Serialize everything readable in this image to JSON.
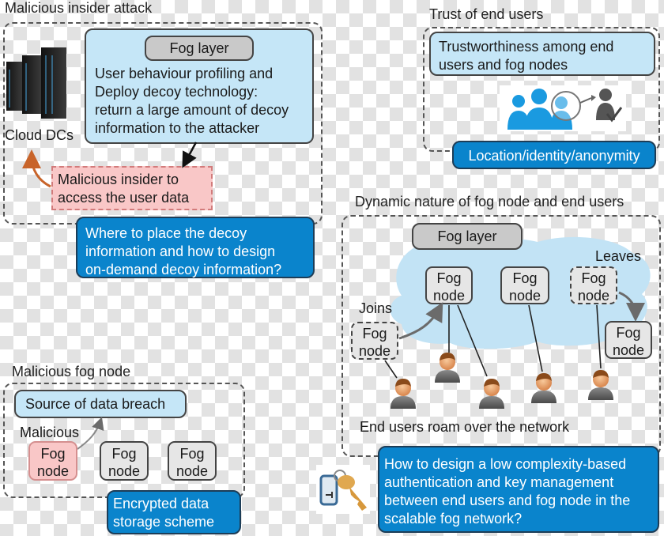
{
  "colors": {
    "light_blue_box": "#c5e6f7",
    "dark_blue_box": "#0a84cc",
    "grey_pill": "#c9c9c9",
    "red_box": "#f9c7c7",
    "cloud": "#c2e3f5",
    "orange_arrow": "#c8642a"
  },
  "insider": {
    "title": "Malicious insider attack",
    "fog_layer": "Fog layer",
    "desc_lines": [
      "User behaviour profiling and",
      "Deploy decoy technology:",
      "return a large amount of decoy",
      "information to the attacker"
    ],
    "cloud_label": "Cloud DCs",
    "attack_lines": [
      "Malicious insider to",
      "access the user data"
    ],
    "question_lines": [
      "Where to place the decoy",
      "information and how to design",
      "on-demand decoy information?"
    ]
  },
  "trust": {
    "title": "Trust of end users",
    "desc_lines": [
      "Trustworthiness among end",
      "users and fog nodes"
    ],
    "issue": "Location/identity/anonymity"
  },
  "dynamic": {
    "title": "Dynamic nature of fog node and end users",
    "fog_layer": "Fog layer",
    "node_line1": "Fog",
    "node_line2": "node",
    "joins": "Joins",
    "leaves": "Leaves",
    "roam": "End users roam over the network",
    "question_lines": [
      "How to design a low complexity-based",
      "authentication and key management",
      "between end users and fog node in the",
      "scalable fog network?"
    ]
  },
  "malnode": {
    "title": "Malicious fog node",
    "breach": "Source of data breach",
    "malicious_label": "Malicious",
    "node_line1": "Fog",
    "node_line2": "node",
    "scheme_lines": [
      "Encrypted data",
      "storage scheme"
    ]
  }
}
